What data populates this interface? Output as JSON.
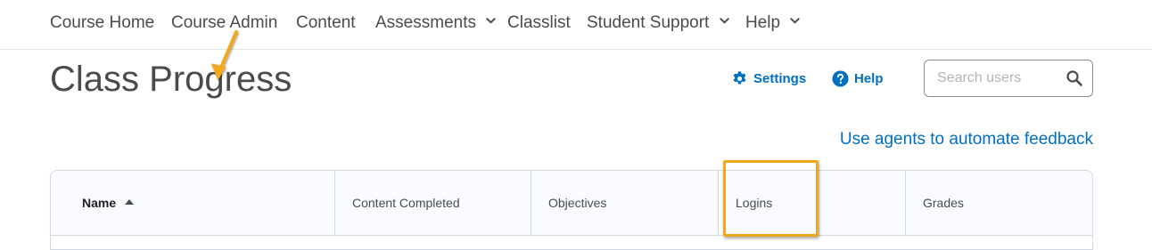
{
  "nav": {
    "items": [
      {
        "label": "Course Home",
        "has_dropdown": false
      },
      {
        "label": "Course Admin",
        "has_dropdown": false
      },
      {
        "label": "Content",
        "has_dropdown": false
      },
      {
        "label": "Assessments",
        "has_dropdown": true
      },
      {
        "label": "Classlist",
        "has_dropdown": false
      },
      {
        "label": "Student Support",
        "has_dropdown": true
      },
      {
        "label": "Help",
        "has_dropdown": true
      }
    ]
  },
  "page": {
    "title": "Class Progress"
  },
  "actions": {
    "settings_label": "Settings",
    "settings_icon": "gear-icon",
    "help_label": "Help",
    "help_icon": "question-circle-icon"
  },
  "search": {
    "placeholder": "Search users",
    "value": "",
    "icon": "search-icon"
  },
  "feedback_link": "Use agents to automate feedback",
  "table": {
    "columns": [
      {
        "label": "Name",
        "sorted": "ascending"
      },
      {
        "label": "Content Completed"
      },
      {
        "label": "Objectives"
      },
      {
        "label": "Logins"
      },
      {
        "label": "Grades"
      }
    ]
  },
  "colors": {
    "link": "#006fbf",
    "text": "#494c4e",
    "annotation": "#f0a81a",
    "table_header_bg": "#f9fbff",
    "border": "#d3d9e3"
  }
}
